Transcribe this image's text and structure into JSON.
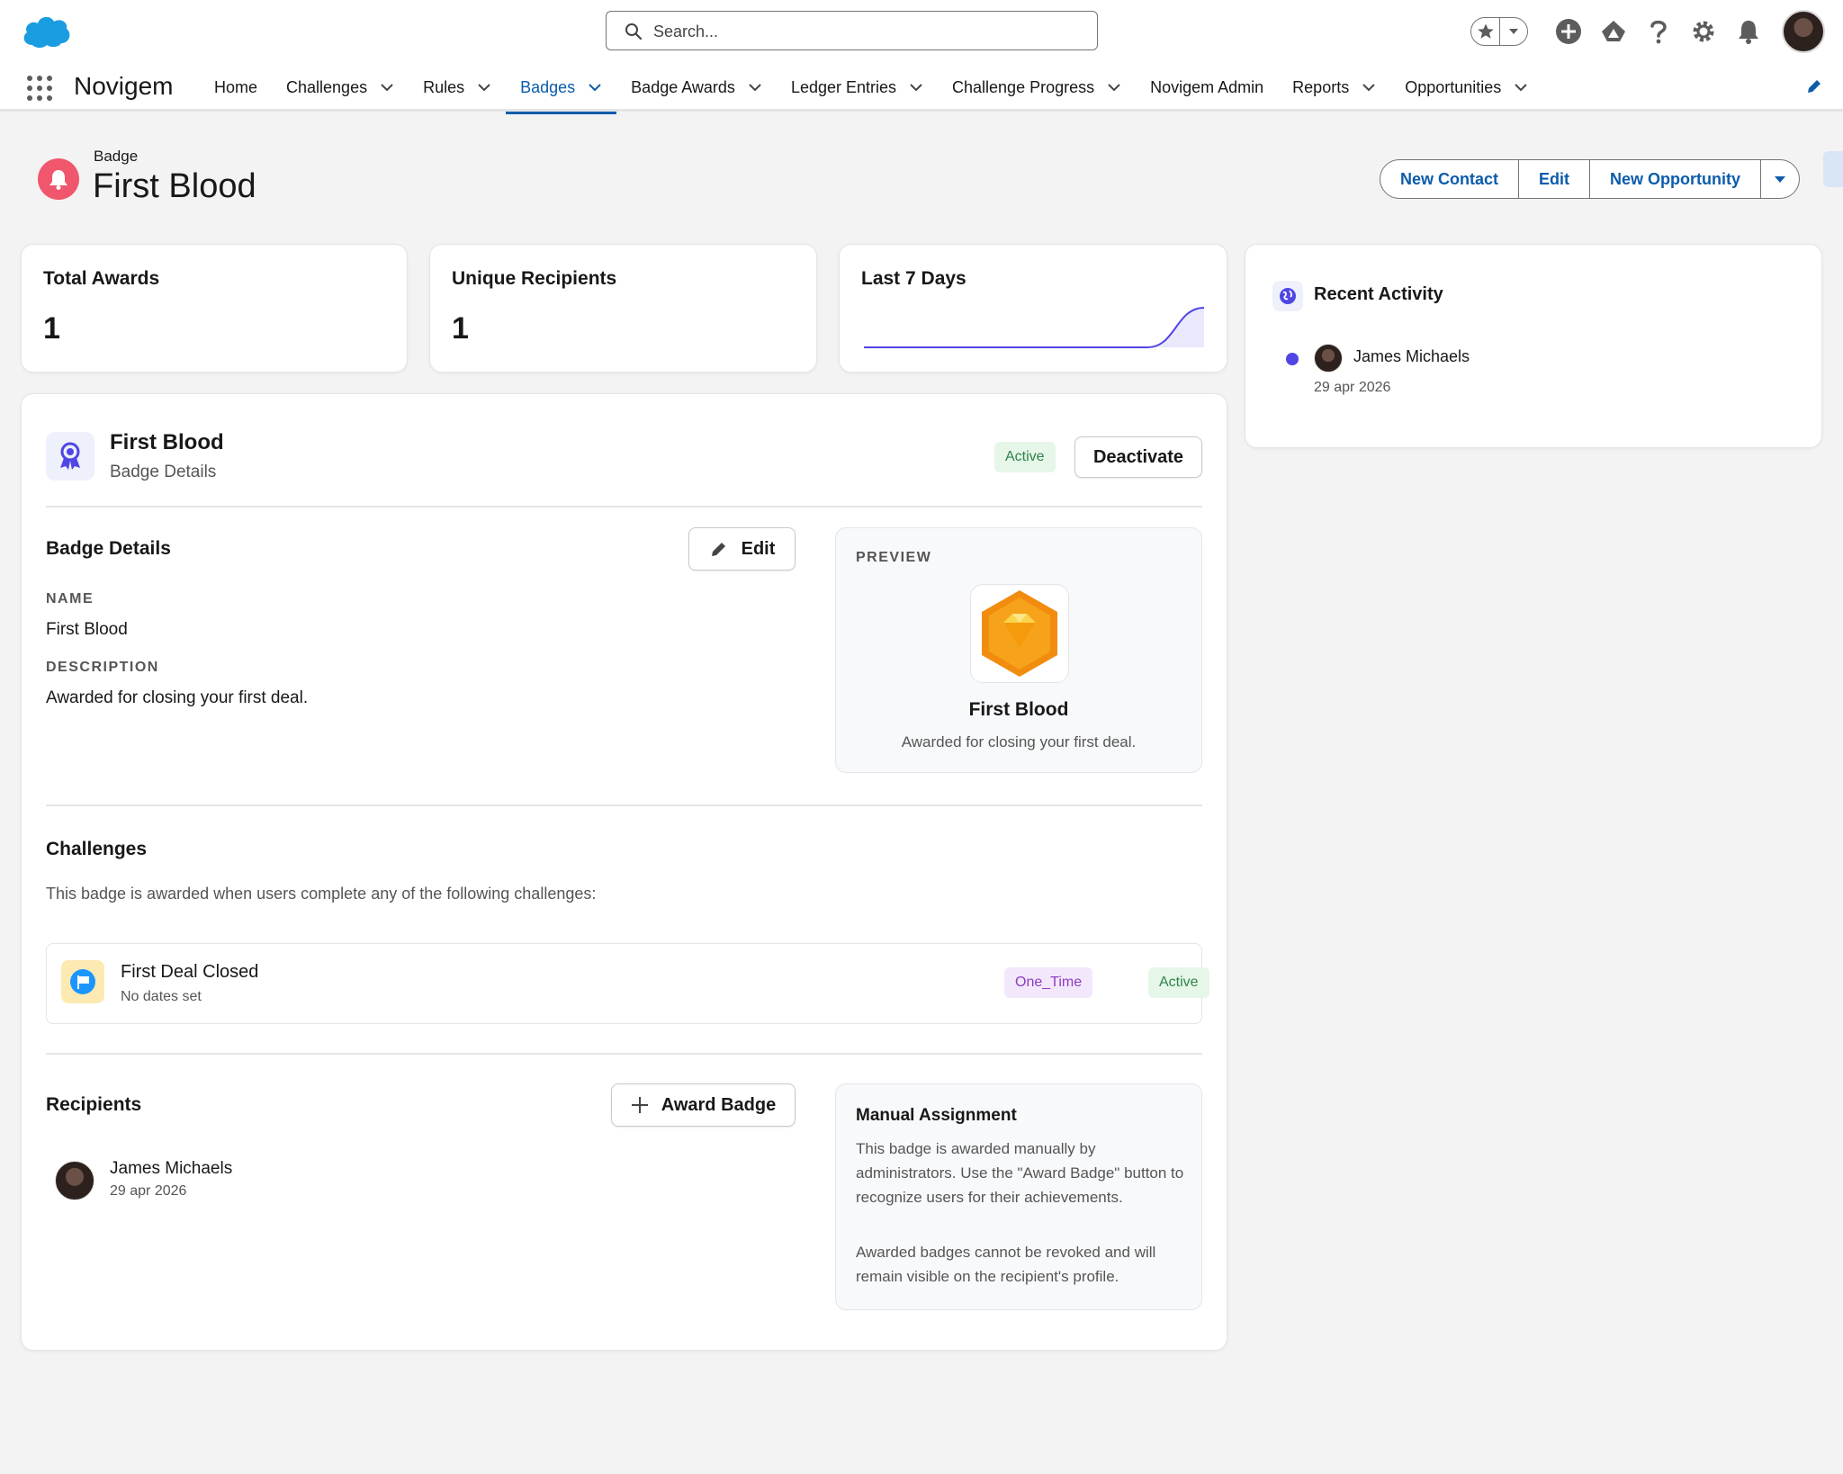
{
  "global_header": {
    "search_placeholder": "Search..."
  },
  "app_nav": {
    "app_name": "Novigem",
    "items": [
      {
        "label": "Home",
        "has_menu": false
      },
      {
        "label": "Challenges",
        "has_menu": true
      },
      {
        "label": "Rules",
        "has_menu": true
      },
      {
        "label": "Badges",
        "has_menu": true,
        "active": true
      },
      {
        "label": "Badge Awards",
        "has_menu": true
      },
      {
        "label": "Ledger Entries",
        "has_menu": true
      },
      {
        "label": "Challenge Progress",
        "has_menu": true
      },
      {
        "label": "Novigem Admin",
        "has_menu": false
      },
      {
        "label": "Reports",
        "has_menu": true
      },
      {
        "label": "Opportunities",
        "has_menu": true
      }
    ]
  },
  "page_header": {
    "object_label": "Badge",
    "title": "First Blood",
    "actions": [
      "New Contact",
      "Edit",
      "New Opportunity"
    ]
  },
  "stats": {
    "total_awards": {
      "label": "Total Awards",
      "value": "1"
    },
    "unique_recipients": {
      "label": "Unique Recipients",
      "value": "1"
    },
    "last_7_days": {
      "label": "Last 7 Days"
    }
  },
  "chart_data": {
    "type": "area",
    "title": "Last 7 Days",
    "x": [
      1,
      2,
      3,
      4,
      5,
      6,
      7
    ],
    "values": [
      0,
      0,
      0,
      0,
      0,
      0,
      1
    ],
    "ylim": [
      0,
      1
    ],
    "grid": false,
    "color": "#4f46e5"
  },
  "recent_activity": {
    "title": "Recent Activity",
    "items": [
      {
        "name": "James Michaels",
        "date": "29 apr 2026"
      }
    ]
  },
  "badge": {
    "title": "First Blood",
    "subtitle": "Badge Details",
    "status": "Active",
    "deactivate_label": "Deactivate"
  },
  "details": {
    "section_title": "Badge Details",
    "edit_label": "Edit",
    "name_label": "NAME",
    "name_value": "First Blood",
    "description_label": "DESCRIPTION",
    "description_value": "Awarded for closing your first deal."
  },
  "preview": {
    "label": "PREVIEW",
    "name": "First Blood",
    "description": "Awarded for closing your first deal."
  },
  "challenges": {
    "section_title": "Challenges",
    "intro": "This badge is awarded when users complete any of the following challenges:",
    "items": [
      {
        "name": "First Deal Closed",
        "dates": "No dates set",
        "type": "One_Time",
        "status": "Active"
      }
    ]
  },
  "recipients": {
    "section_title": "Recipients",
    "award_label": "Award Badge",
    "items": [
      {
        "name": "James Michaels",
        "date": "29 apr 2026"
      }
    ]
  },
  "manual_assignment": {
    "title": "Manual Assignment",
    "paragraph_1": "This badge is awarded manually by administrators. Use the \"Award Badge\" button to recognize users for their achievements.",
    "paragraph_2": "Awarded badges cannot be revoked and will remain visible on the recipient's profile."
  },
  "colors": {
    "brand_blue": "#0b5cab",
    "accent_indigo": "#4f46e5",
    "status_green": "#2e844a",
    "badge_orange": "#f28c0f",
    "page_icon_pink": "#f0566c"
  }
}
